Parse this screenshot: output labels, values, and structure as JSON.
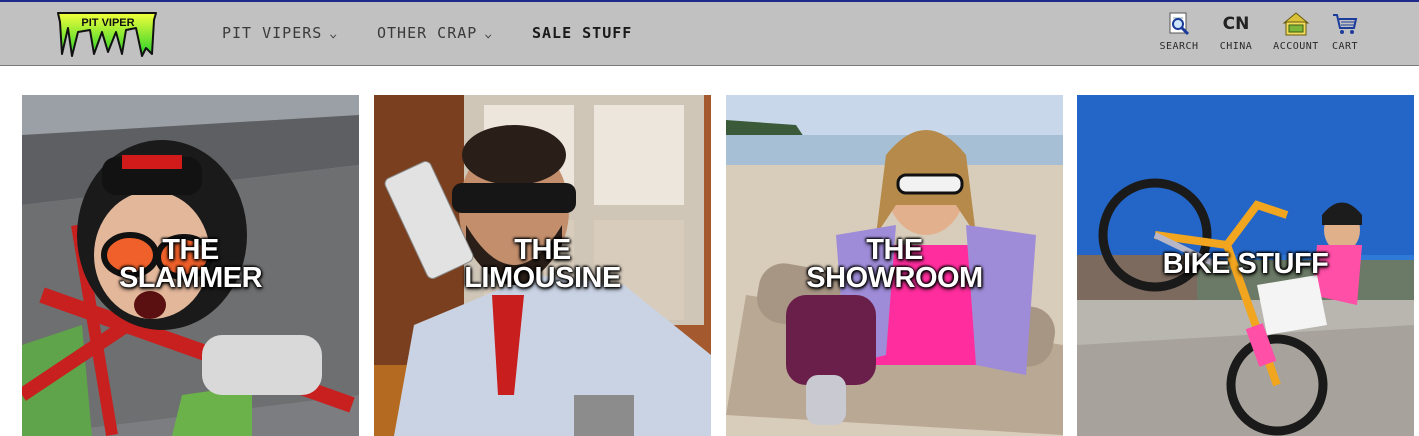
{
  "header": {
    "logo_text": "PIT VIPER",
    "nav": [
      {
        "label": "PIT VIPERS",
        "has_dropdown": true
      },
      {
        "label": "OTHER CRAP",
        "has_dropdown": true
      },
      {
        "label": "SALE STUFF",
        "has_dropdown": false
      }
    ],
    "utilities": {
      "search": {
        "label": "SEARCH",
        "icon": "search-icon"
      },
      "country": {
        "code": "CN",
        "label": "CHINA"
      },
      "account": {
        "label": "ACCOUNT",
        "icon": "account-icon"
      },
      "cart": {
        "label": "CART",
        "icon": "cart-icon"
      }
    }
  },
  "tiles": [
    {
      "line1": "THE",
      "line2": "SLAMMER"
    },
    {
      "line1": "THE",
      "line2": "LIMOUSINE"
    },
    {
      "line1": "THE",
      "line2": "SHOWROOM"
    },
    {
      "line1": "BIKE STUFF"
    }
  ],
  "colors": {
    "header_bg": "#c1c1c1",
    "header_top_border": "#1d2b8a",
    "logo_gradient_top": "#e8ff2a",
    "logo_gradient_bottom": "#2fdc2f"
  }
}
